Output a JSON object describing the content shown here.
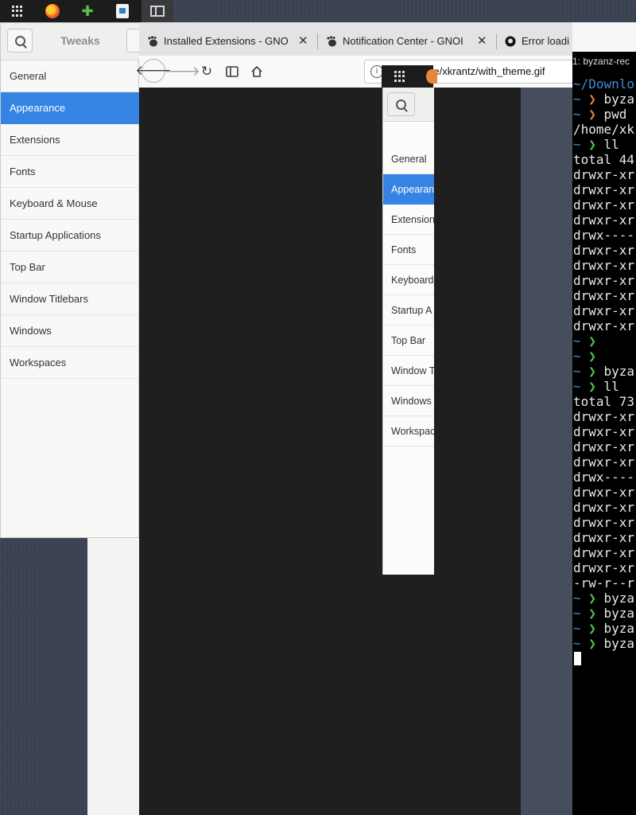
{
  "tweaks": {
    "title": "Tweaks",
    "nav": [
      "General",
      "Appearance",
      "Extensions",
      "Fonts",
      "Keyboard & Mouse",
      "Startup Applications",
      "Top Bar",
      "Window Titlebars",
      "Windows",
      "Workspaces"
    ],
    "selected": "Appearance"
  },
  "browser": {
    "tabs": [
      {
        "label": "Installed Extensions - GNO",
        "icon": "gnome-foot-icon"
      },
      {
        "label": "Notification Center - GNOI",
        "icon": "gnome-foot-icon"
      },
      {
        "label": "Error loadi",
        "icon": "github-icon"
      }
    ],
    "url": "file:///home/xkrantz/with_theme.gif"
  },
  "gif_preview": {
    "nav": [
      "General",
      "Appearan",
      "Extension",
      "Fonts",
      "Keyboard",
      "Startup A",
      "Top Bar",
      "Window T",
      "Windows",
      "Workspac"
    ]
  },
  "terminal": {
    "title": "1: byzanz-rec",
    "lines": [
      {
        "text": "~/Downlo",
        "cls": "c-blue"
      },
      {
        "prompt": "~ ❯ ",
        "pcls": "c-orange",
        "text": "byza"
      },
      {
        "prompt": "~ ❯ ",
        "pcls": "c-orange",
        "text": "pwd"
      },
      {
        "text": "/home/xk"
      },
      {
        "prompt": "~ ❯ ",
        "pcls": "c-green",
        "text": "ll"
      },
      {
        "text": "total 44"
      },
      {
        "text": "drwxr-xr"
      },
      {
        "text": "drwxr-xr"
      },
      {
        "text": "drwxr-xr"
      },
      {
        "text": "drwxr-xr"
      },
      {
        "text": "drwx----"
      },
      {
        "text": "drwxr-xr"
      },
      {
        "text": "drwxr-xr"
      },
      {
        "text": "drwxr-xr"
      },
      {
        "text": "drwxr-xr"
      },
      {
        "text": "drwxr-xr"
      },
      {
        "text": "drwxr-xr"
      },
      {
        "prompt": "~ ❯",
        "pcls": "c-green",
        "text": ""
      },
      {
        "prompt": "~ ❯",
        "pcls": "c-green",
        "text": ""
      },
      {
        "prompt": "~ ❯ ",
        "pcls": "c-green",
        "text": "byza"
      },
      {
        "prompt": "~ ❯ ",
        "pcls": "c-green",
        "text": "ll"
      },
      {
        "text": "total 73"
      },
      {
        "text": "drwxr-xr"
      },
      {
        "text": "drwxr-xr"
      },
      {
        "text": "drwxr-xr"
      },
      {
        "text": "drwxr-xr"
      },
      {
        "text": "drwx----"
      },
      {
        "text": "drwxr-xr"
      },
      {
        "text": "drwxr-xr"
      },
      {
        "text": "drwxr-xr"
      },
      {
        "text": "drwxr-xr"
      },
      {
        "text": "drwxr-xr"
      },
      {
        "text": "drwxr-xr"
      },
      {
        "text": "-rw-r--r"
      },
      {
        "prompt": "~ ❯ ",
        "pcls": "c-green",
        "text": "byza"
      },
      {
        "prompt": "~ ❯ ",
        "pcls": "c-green",
        "text": "byza"
      },
      {
        "prompt": "~ ❯ ",
        "pcls": "c-green",
        "text": "byza"
      },
      {
        "prompt": "~ ❯ ",
        "pcls": "c-green",
        "text": "byza"
      }
    ]
  },
  "topbar": {
    "icons": [
      "app-grid-icon",
      "firefox-icon",
      "extensions-puzzle-icon",
      "image-viewer-icon",
      "window-switcher-icon"
    ]
  }
}
